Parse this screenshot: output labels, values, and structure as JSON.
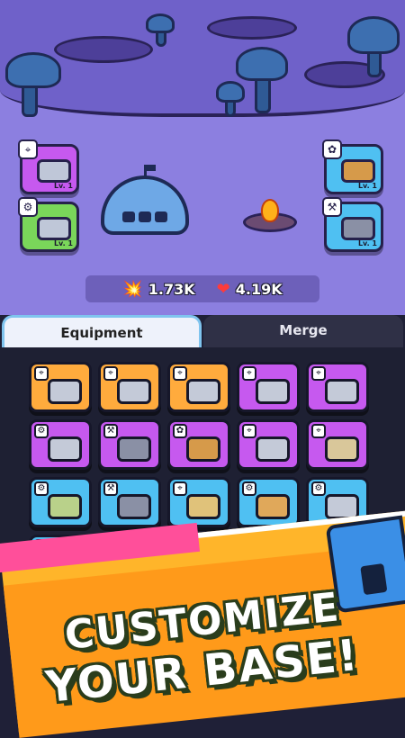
{
  "scene": {
    "base_slots_left": [
      {
        "level": "Lv. 1",
        "color": "#c659ef",
        "icon": "gatling-gun-icon",
        "tag": "target-icon"
      },
      {
        "level": "Lv. 1",
        "color": "#7ad65a",
        "icon": "saw-blade-icon",
        "tag": "gear-icon"
      }
    ],
    "base_slots_right": [
      {
        "level": "Lv. 1",
        "color": "#4fc0f2",
        "icon": "gem-bag-icon",
        "tag": "fish-icon"
      },
      {
        "level": "Lv. 1",
        "color": "#4fc0f2",
        "icon": "ore-cart-icon",
        "tag": "pickaxe-icon"
      }
    ]
  },
  "stats": {
    "attack_value": "1.73K",
    "attack_icon": "explosion-icon",
    "health_value": "4.19K",
    "health_icon": "heart-icon"
  },
  "tabs": {
    "equipment": "Equipment",
    "merge": "Merge"
  },
  "inventory": {
    "colors": {
      "orange": "#ffab3d",
      "purple": "#c659ef",
      "blue": "#4fc0f2",
      "green": "#7ad65a"
    }
  },
  "banner": {
    "line1": "CUSTOMIZE",
    "line2": "YOUR BASE!"
  }
}
